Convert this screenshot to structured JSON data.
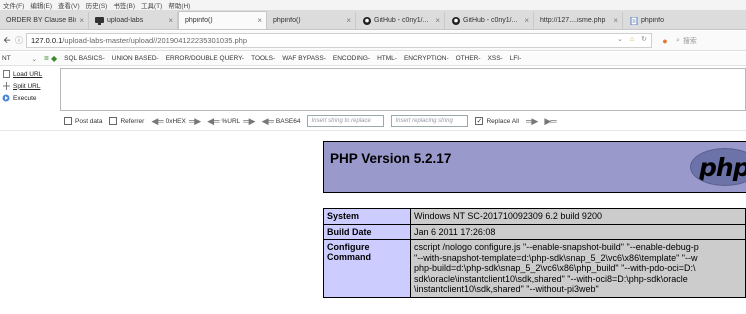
{
  "menubar": {
    "items": [
      "文件(F)",
      "编辑(E)",
      "查看(V)",
      "历史(S)",
      "书签(B)",
      "工具(T)",
      "帮助(H)"
    ]
  },
  "tabs": [
    {
      "title": "ORDER BY Clause Bli...",
      "icon": "none",
      "active": false
    },
    {
      "title": "upload-labs",
      "icon": "monitor-icon",
      "active": false
    },
    {
      "title": "phpinfo()",
      "icon": "none",
      "active": true
    },
    {
      "title": "phpinfo()",
      "icon": "none",
      "active": false
    },
    {
      "title": "GitHub - c0ny1/...",
      "icon": "github-icon",
      "active": false
    },
    {
      "title": "GitHub - c0ny1/...",
      "icon": "github-icon",
      "active": false
    },
    {
      "title": "http://127....isme.php",
      "icon": "none",
      "active": false
    },
    {
      "title": "phpinfo",
      "icon": "page-icon",
      "active": false
    }
  ],
  "urlbar": {
    "host": "127.0.0.1",
    "path": "/upload-labs-master/upload//201904122235301035.php",
    "search_placeholder": "搜索"
  },
  "hackbar": {
    "menu": [
      "NT",
      "SQL BASICS-",
      "UNION BASED-",
      "ERROR/DOUBLE QUERY-",
      "TOOLS-",
      "WAF BYPASS-",
      "ENCODING-",
      "HTML-",
      "ENCRYPTION-",
      "OTHER-",
      "XSS-",
      "LFI-"
    ],
    "side": {
      "load": "Load URL",
      "split": "Split URL",
      "execute": "Execute"
    },
    "options": {
      "post_data": "Post data",
      "referrer": "Referrer",
      "hex": "0xHEX",
      "url": "%URL",
      "base64": "BASE64",
      "replace_placeholder": "Insert string to replace",
      "replacing_placeholder": "Insert replacing string",
      "replace_all": "Replace All"
    }
  },
  "phpinfo": {
    "title": "PHP Version 5.2.17",
    "logo": "php",
    "rows": [
      {
        "key": "System",
        "lines": [
          "Windows NT SC-201710092309 6.2 build 9200"
        ]
      },
      {
        "key": "Build Date",
        "lines": [
          "Jan 6 2011 17:26:08"
        ]
      },
      {
        "key": "Configure Command",
        "lines": [
          "cscript /nologo configure.js \"--enable-snapshot-build\" \"--enable-debug-p",
          "\"--with-snapshot-template=d:\\php-sdk\\snap_5_2\\vc6\\x86\\template\" \"--w",
          "php-build=d:\\php-sdk\\snap_5_2\\vc6\\x86\\php_build\" \"--with-pdo-oci=D:\\",
          "sdk\\oracle\\instantclient10\\sdk,shared\" \"--with-oci8=D:\\php-sdk\\oracle",
          "\\instantclient10\\sdk,shared\" \"--without-pi3web\""
        ]
      }
    ]
  },
  "colors": {
    "php_header": "#9999cc",
    "php_key": "#ccccff",
    "php_value": "#cccccc"
  }
}
